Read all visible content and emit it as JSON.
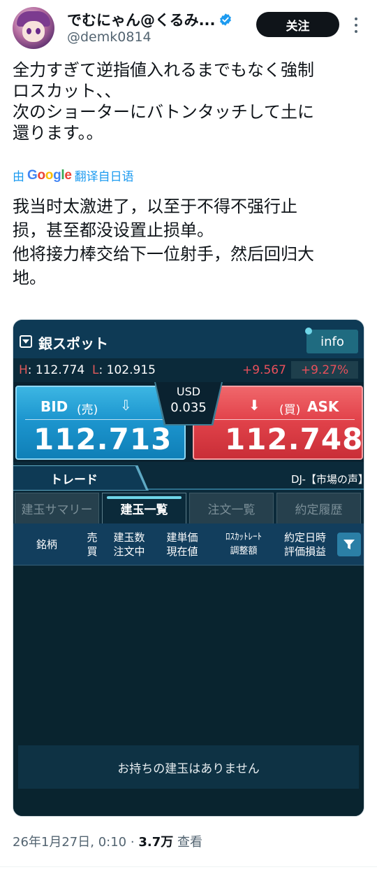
{
  "author": {
    "display_name": "でむにゃん@くるみ...",
    "handle": "@demk0814",
    "follow_label": "关注"
  },
  "tweet": {
    "text": "全力すぎて逆指値入れるまでもなく強制\nロスカット、、\n次のショーターにバトンタッチして土に\n還ります。。",
    "translate_prefix": "由",
    "translate_google": "Google",
    "translate_suffix": "翻译自日语",
    "translated_text": "我当时太激进了，以至于不得不强行止\n损，甚至都没设置止损单。\n他将接力棒交给下一位射手，然后回归大\n地。",
    "date": "26年1月27日, 0:10",
    "separator": "·",
    "views": "3.7万",
    "views_label": "查看"
  },
  "app": {
    "title": "銀スポット",
    "info_label": "info",
    "high_label": "H",
    "high_value": ": 112.774",
    "low_label": "L",
    "low_value": ": 102.915",
    "change_value": "+9.567",
    "change_pct": "+9.27%",
    "bid_label": "BID",
    "bid_side": "(売)",
    "bid_price": "112.713",
    "ask_label": "ASK",
    "ask_side": "(買)",
    "ask_price": "112.748",
    "spread_ccy": "USD",
    "spread_value": "0.035",
    "trade_tab": "トレード",
    "news_ticker": "DJ-【市場の声】",
    "subtabs": [
      "建玉サマリー",
      "建玉一覧",
      "注文一覧",
      "約定履歴"
    ],
    "columns": [
      "銘柄",
      "売\n買",
      "建玉数\n注文中",
      "建単価\n現在値",
      "ﾛｽｶｯﾄﾚｰﾄ\n調整額",
      "約定日時\n評価損益"
    ],
    "empty_message": "お持ちの建玉はありません"
  },
  "colors": {
    "bid_blue": "#1d96cf",
    "ask_red": "#e2434b",
    "change_red": "#e8505b",
    "verified_blue": "#1d9bf0",
    "app_bg": "#0b2a3a"
  },
  "icons": [
    "verified-badge-icon",
    "more-dots-icon",
    "dropdown-icon",
    "bid-down-arrow-icon",
    "ask-down-arrow-icon",
    "filter-icon"
  ]
}
